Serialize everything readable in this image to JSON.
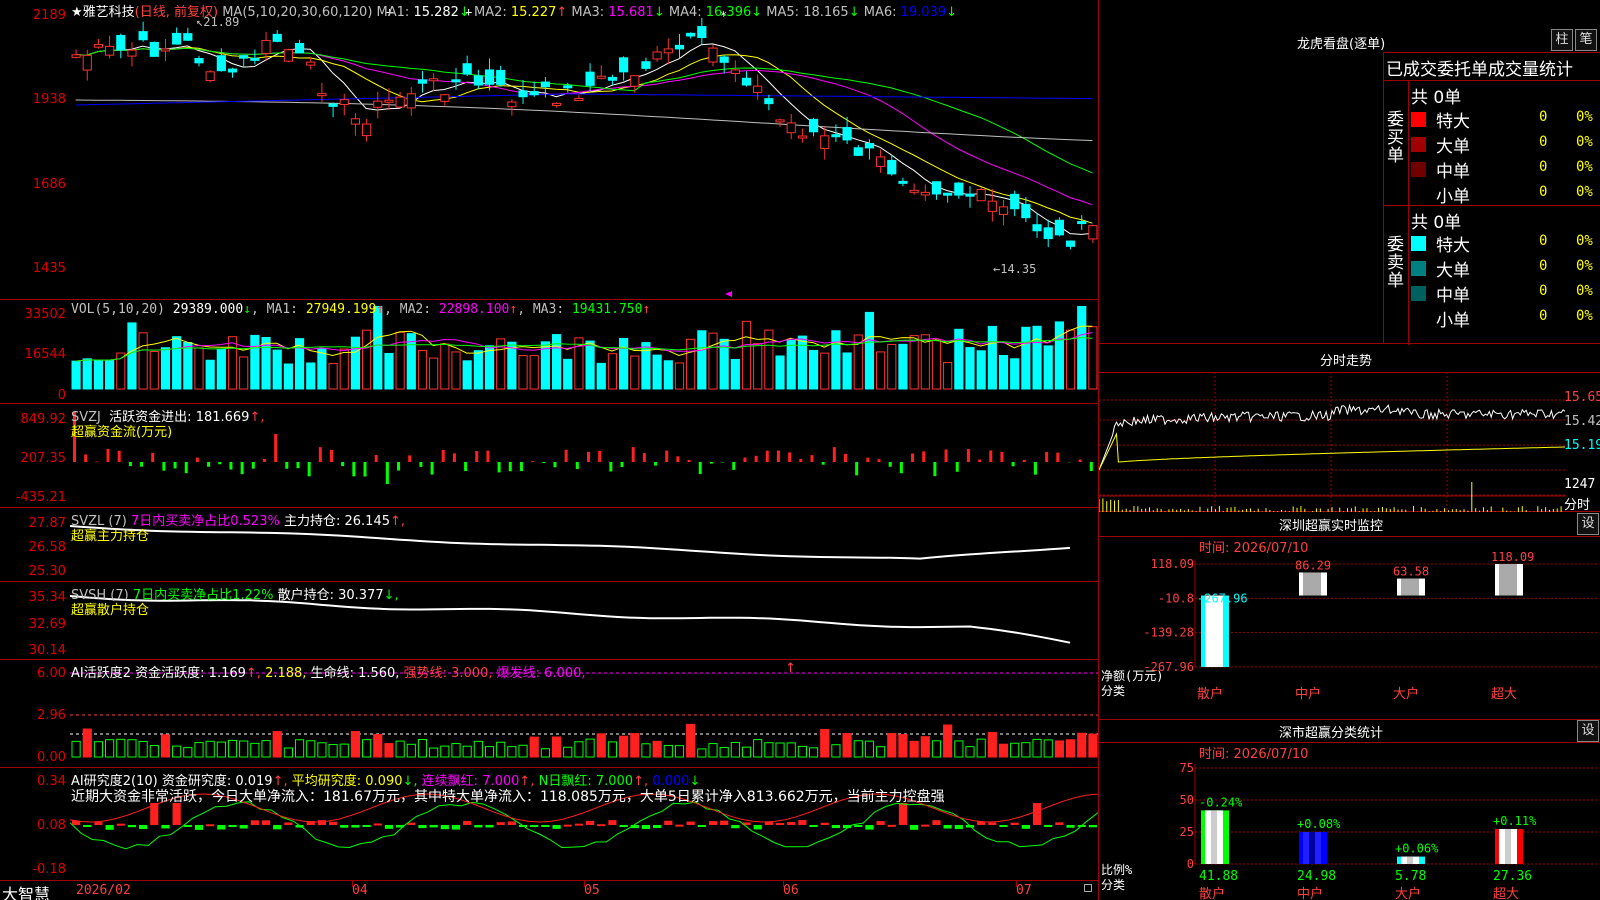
{
  "stock": {
    "name": "★雅艺科技",
    "mode": "(日线, 前复权)"
  },
  "main": {
    "ma_header": "MA(5,10,20,30,60,120)",
    "ma": [
      {
        "label": "MA1:",
        "value": "15.282",
        "arrow": "↓",
        "color": "#ffffff"
      },
      {
        "label": "MA2:",
        "value": "15.227",
        "arrow": "↑",
        "color": "#ffff00"
      },
      {
        "label": "MA3:",
        "value": "15.681",
        "arrow": "↓",
        "color": "#ff00ff"
      },
      {
        "label": "MA4:",
        "value": "16.396",
        "arrow": "↓",
        "color": "#00ff00"
      },
      {
        "label": "MA5:",
        "value": "18.165",
        "arrow": "↓",
        "color": "#c0c0c0"
      },
      {
        "label": "MA6:",
        "value": "19.039",
        "arrow": "↓",
        "color": "#0000ff"
      }
    ],
    "y_labels": [
      "2189",
      "1938",
      "1686",
      "1435"
    ],
    "high_label": "21.89",
    "low_label": "←14.35"
  },
  "vol": {
    "header": "VOL(5,10,20)",
    "value": "29389.000",
    "arrow": "↓",
    "ma": [
      {
        "label": "MA1:",
        "value": "27949.199",
        "arrow": "↑",
        "color": "#ffff00"
      },
      {
        "label": "MA2:",
        "value": "22898.100",
        "arrow": "↑",
        "color": "#ff00ff"
      },
      {
        "label": "MA3:",
        "value": "19431.750",
        "arrow": "↑",
        "color": "#00ff00"
      }
    ],
    "y_labels": [
      "33502",
      "16544",
      "0"
    ]
  },
  "svzj": {
    "name": "SVZJ",
    "label": "活跃资金进出:",
    "value": "181.669",
    "arrow": "↑,",
    "sub": "超赢资金流(万元)",
    "y_labels": [
      "849.92",
      "207.35",
      "-435.21"
    ]
  },
  "svzl": {
    "name": "SVZL (7)",
    "pct": "7日内买卖净占比0.523%",
    "label": "主力持仓:",
    "value": "26.145",
    "arrow": "↑,",
    "sub": "超赢主力持仓",
    "y_labels": [
      "27.87",
      "26.58",
      "25.30"
    ]
  },
  "svsh": {
    "name": "SVSH (7)",
    "pct": "7日内买卖净占比1.22%",
    "label": "散户持仓:",
    "value": "30.377",
    "arrow": "↓,",
    "sub": "超赢散户持仓",
    "y_labels": [
      "35.34",
      "32.69",
      "30.14"
    ]
  },
  "ai1": {
    "name": "AI活跃度2",
    "l1": "资金活跃度:",
    "v1": "1.169",
    "a1": "↑,",
    "v2": "2.188,",
    "l3": "生命线:",
    "v3": "1.560,",
    "l4": "强势线:",
    "v4": "3.000,",
    "l5": "爆发线:",
    "v5": "6.000,",
    "mark": "↑",
    "y_labels": [
      "6.00",
      "2.96",
      "0.00"
    ]
  },
  "ai2": {
    "name": "AI研究度2(10)",
    "l1": "资金研究度:",
    "v1": "0.019",
    "a1": "↑,",
    "l2": "平均研究度:",
    "v2": "0.090",
    "a2": "↓,",
    "l3": "连续飘红:",
    "v3": "7.000",
    "a3": "↑,",
    "l4": "N日飘红:",
    "v4": "7.000",
    "a4": "↑,",
    "v5": "0.000",
    "a5": "↓",
    "comment": "近期大资金非常活跃，今日大单净流入：181.67万元，其中特大单净流入：118.085万元，大单5日累计净入813.662万元，当前主力控盘强",
    "y_labels": [
      "0.34",
      "0.08",
      "-0.18"
    ]
  },
  "xaxis": {
    "logo": "大智慧",
    "labels": [
      "2026/02",
      "04",
      "05",
      "06",
      "07"
    ]
  },
  "dragon": {
    "title": "龙虎看盘(逐单)",
    "btn1": "柱",
    "btn2": "笔",
    "stat_title": "已成交委托单成交量统计",
    "buy": {
      "side": "委买单",
      "total": "共 0单",
      "rows": [
        {
          "name": "特大",
          "vol": "0",
          "pct": "0%",
          "color": "#ff0000"
        },
        {
          "name": "大单",
          "vol": "0",
          "pct": "0%",
          "color": "#a00000"
        },
        {
          "name": "中单",
          "vol": "0",
          "pct": "0%",
          "color": "#700000"
        },
        {
          "name": "小单",
          "vol": "0",
          "pct": "0%",
          "color": "#000000"
        }
      ]
    },
    "sell": {
      "side": "委卖单",
      "total": "共 0单",
      "rows": [
        {
          "name": "特大",
          "vol": "0",
          "pct": "0%",
          "color": "#00ffff"
        },
        {
          "name": "大单",
          "vol": "0",
          "pct": "0%",
          "color": "#008080"
        },
        {
          "name": "中单",
          "vol": "0",
          "pct": "0%",
          "color": "#006060"
        },
        {
          "name": "小单",
          "vol": "0",
          "pct": "0%",
          "color": "#000000"
        }
      ]
    }
  },
  "intraday": {
    "title": "分时走势",
    "prices": [
      "15.65",
      "15.42",
      "15.19"
    ],
    "vol_label": "1247",
    "vol_unit": "分时"
  },
  "sz_monitor": {
    "title": "深圳超赢实时监控",
    "btn": "设",
    "time": "时间: 2026/07/10",
    "y_labels": [
      "118.09",
      "-10.8",
      "-139.28",
      "-267.96"
    ],
    "footer1": "净额(万元)",
    "footer2": "分类",
    "bars": [
      {
        "cat": "散户",
        "value": -267.96,
        "label": "-267.96"
      },
      {
        "cat": "中户",
        "value": 86.29,
        "label": "86.29"
      },
      {
        "cat": "大户",
        "value": 63.58,
        "label": "63.58"
      },
      {
        "cat": "超大",
        "value": 118.09,
        "label": "118.09"
      }
    ]
  },
  "sz_class": {
    "title": "深市超赢分类统计",
    "btn": "设",
    "time": "时间: 2026/07/10",
    "y_labels": [
      "75",
      "50",
      "25",
      "0"
    ],
    "footer1": "比例%",
    "footer2": "分类",
    "bars": [
      {
        "cat": "散户",
        "pct": 41.88,
        "label": "41.88",
        "delta": "-0.24%",
        "color": "#ffffff"
      },
      {
        "cat": "中户",
        "pct": 24.98,
        "label": "24.98",
        "delta": "+0.08%",
        "color": "#0000ff"
      },
      {
        "cat": "大户",
        "pct": 5.78,
        "label": "5.78",
        "delta": "+0.06%",
        "color": "#ffffff"
      },
      {
        "cat": "超大",
        "pct": 27.36,
        "label": "27.36",
        "delta": "+0.11%",
        "color": "#ff0000"
      }
    ]
  }
}
